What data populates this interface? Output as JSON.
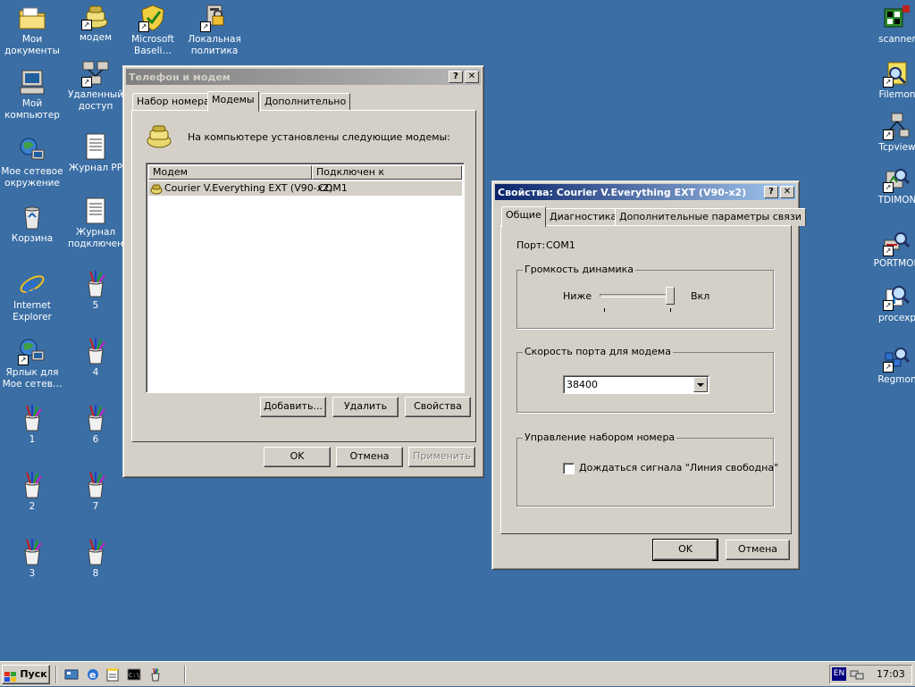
{
  "desktop_left": [
    {
      "label": "Мои\nдокументы",
      "icon": "folder-icon"
    },
    {
      "label": "Мой\nкомпьютер",
      "icon": "computer-icon"
    },
    {
      "label": "Мое сетевое\nокружение",
      "icon": "network-icon"
    },
    {
      "label": "Корзина",
      "icon": "recycle-bin-icon"
    },
    {
      "label": "Internet\nExplorer",
      "icon": "ie-icon"
    },
    {
      "label": "Ярлык для\nМое сетев…",
      "icon": "network-shortcut-icon"
    },
    {
      "label": "1",
      "icon": "paint-bucket-icon"
    },
    {
      "label": "2",
      "icon": "paint-bucket-icon"
    },
    {
      "label": "3",
      "icon": "paint-bucket-icon"
    }
  ],
  "desktop_col2": [
    {
      "label": "модем",
      "icon": "modem-icon"
    },
    {
      "label": "Удаленный\nдоступ",
      "icon": "remote-access-icon"
    },
    {
      "label": "Журнал PP",
      "icon": "document-icon"
    },
    {
      "label": "Журнал\nподключен",
      "icon": "document-icon"
    },
    {
      "label": "5",
      "icon": "paint-bucket-icon"
    },
    {
      "label": "4",
      "icon": "paint-bucket-icon"
    },
    {
      "label": "6",
      "icon": "paint-bucket-icon"
    },
    {
      "label": "7",
      "icon": "paint-bucket-icon"
    },
    {
      "label": "8",
      "icon": "paint-bucket-icon"
    }
  ],
  "desktop_top": [
    {
      "label": "Microsoft\nBaseli…",
      "icon": "baseline-analyzer-icon"
    },
    {
      "label": "Локальная\nполитика б…",
      "icon": "security-policy-icon"
    }
  ],
  "desktop_right": [
    {
      "label": "scanner",
      "icon": "scanner-icon"
    },
    {
      "label": "Filemon",
      "icon": "filemon-icon"
    },
    {
      "label": "Tcpview",
      "icon": "tcpview-icon"
    },
    {
      "label": "TDIMON",
      "icon": "tdimon-icon"
    },
    {
      "label": "PORTMON",
      "icon": "portmon-icon"
    },
    {
      "label": "procexp",
      "icon": "procexp-icon"
    },
    {
      "label": "Regmon",
      "icon": "regmon-icon"
    }
  ],
  "phone_dialog": {
    "title": "Телефон и модем",
    "tabs": [
      "Набор номера",
      "Модемы",
      "Дополнительно"
    ],
    "intro": "На компьютере установлены следующие модемы:",
    "columns": [
      "Модем",
      "Подключен к"
    ],
    "rows": [
      {
        "modem": "Courier V.Everything EXT (V90-x2)",
        "port": "COM1"
      }
    ],
    "buttons": {
      "add": "Добавить...",
      "remove": "Удалить",
      "props": "Свойства"
    },
    "footer": {
      "ok": "OK",
      "cancel": "Отмена",
      "apply": "Применить"
    }
  },
  "props_dialog": {
    "title": "Свойства: Courier V.Everything EXT (V90-x2)",
    "tabs": [
      "Общие",
      "Диагностика",
      "Дополнительные параметры связи"
    ],
    "port_label": "Порт:",
    "port_value": "COM1",
    "volume_group": "Громкость динамика",
    "volume_low": "Ниже",
    "volume_high": "Вкл",
    "volume_level": 1.0,
    "speed_group": "Скорость порта для модема",
    "speed_value": "38400",
    "dial_group": "Управление набором номера",
    "dial_checkbox": "Дождаться сигнала \"Линия свободна\"",
    "dial_checked": false,
    "ok": "OK",
    "cancel": "Отмена"
  },
  "taskbar": {
    "start": "Пуск",
    "lang": "EN",
    "clock": "17:03"
  }
}
